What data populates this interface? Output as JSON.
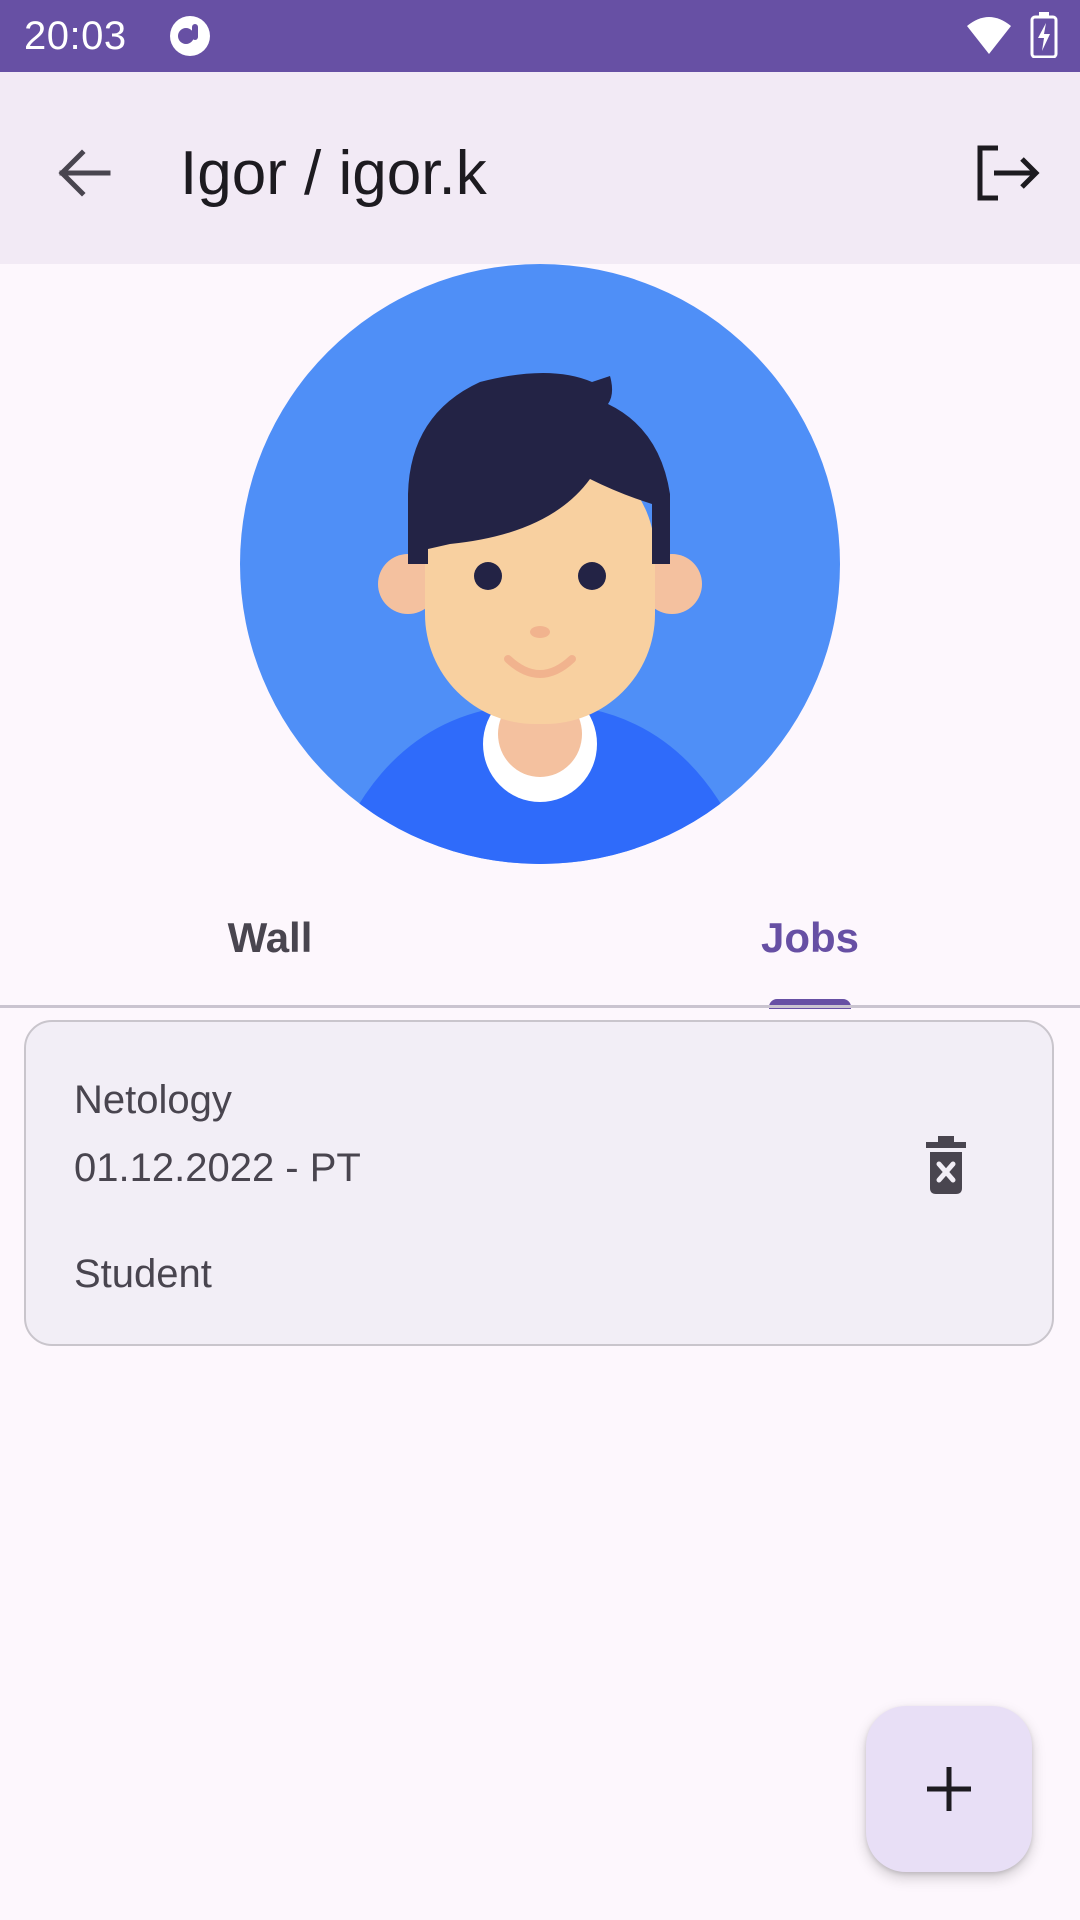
{
  "status_bar": {
    "time": "20:03",
    "icons": [
      "app-notification-icon",
      "wifi-icon",
      "battery-charging-icon"
    ]
  },
  "app_bar": {
    "title": "Igor / igor.k",
    "back_icon": "arrow-back-icon",
    "logout_icon": "logout-icon"
  },
  "profile": {
    "avatar": "user-avatar-illustration"
  },
  "tabs": {
    "items": [
      {
        "label": "Wall",
        "selected": false
      },
      {
        "label": "Jobs",
        "selected": true
      }
    ]
  },
  "jobs": [
    {
      "company": "Netology",
      "period": "01.12.2022 - PT",
      "position": "Student",
      "delete_icon": "delete-icon"
    }
  ],
  "fab": {
    "icon": "add-icon"
  },
  "colors": {
    "primary": "#6750a4",
    "app_bar_bg": "#f2eaf5",
    "background": "#fdf7fd",
    "card_bg": "#f2eef6",
    "fab_bg": "#e8dff6",
    "avatar_bg": "#4f8ff7"
  }
}
